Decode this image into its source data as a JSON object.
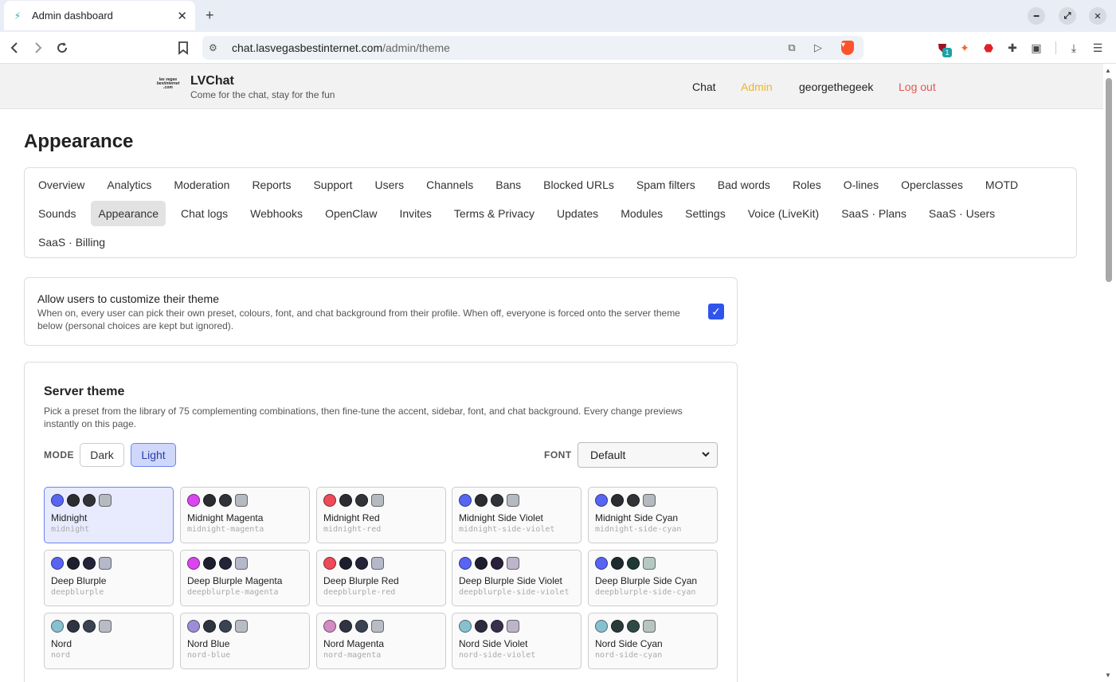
{
  "browser": {
    "tab_title": "Admin dashboard",
    "url_host": "chat.lasvegasbestinternet.com",
    "url_path": "/admin/theme",
    "extension_badge": "1"
  },
  "site": {
    "logo_text": "las vegas bestinternet .com",
    "brand": "LVChat",
    "tagline": "Come for the chat, stay for the fun",
    "nav": {
      "chat": "Chat",
      "admin": "Admin",
      "user": "georgethegeek",
      "logout": "Log out"
    },
    "colors": {
      "admin_link": "#f0b429",
      "logout_link": "#e45656"
    }
  },
  "page": {
    "title": "Appearance"
  },
  "admin_tabs": [
    "Overview",
    "Analytics",
    "Moderation",
    "Reports",
    "Support",
    "Users",
    "Channels",
    "Bans",
    "Blocked URLs",
    "Spam filters",
    "Bad words",
    "Roles",
    "O-lines",
    "Operclasses",
    "MOTD",
    "Sounds",
    "Appearance",
    "Chat logs",
    "Webhooks",
    "OpenClaw",
    "Invites",
    "Terms & Privacy",
    "Updates",
    "Modules",
    "Settings",
    "Voice (LiveKit)",
    "SaaS · Plans",
    "SaaS · Users",
    "SaaS · Billing"
  ],
  "active_tab": "Appearance",
  "allow_customize": {
    "title": "Allow users to customize their theme",
    "description": "When on, every user can pick their own preset, colours, font, and chat background from their profile. When off, everyone is forced onto the server theme below (personal choices are kept but ignored).",
    "checked": true
  },
  "server_theme": {
    "title": "Server theme",
    "description": "Pick a preset from the library of 75 complementing combinations, then fine-tune the accent, sidebar, font, and chat background. Every change previews instantly on this page.",
    "mode_label": "MODE",
    "mode_options": [
      "Dark",
      "Light"
    ],
    "mode_selected": "Light",
    "font_label": "FONT",
    "font_value": "Default"
  },
  "presets": [
    {
      "name": "Midnight",
      "slug": "midnight",
      "colors": [
        "#5865f2",
        "#2b2d31",
        "#313338",
        "#b5bac1"
      ],
      "selected": true
    },
    {
      "name": "Midnight Magenta",
      "slug": "midnight-magenta",
      "colors": [
        "#d946ef",
        "#2b2d31",
        "#313338",
        "#b5bac1"
      ]
    },
    {
      "name": "Midnight Red",
      "slug": "midnight-red",
      "colors": [
        "#ef4a5a",
        "#2b2d31",
        "#313338",
        "#b5bac1"
      ]
    },
    {
      "name": "Midnight Side Violet",
      "slug": "midnight-side-violet",
      "colors": [
        "#5865f2",
        "#2b2d31",
        "#313338",
        "#b5bac1"
      ]
    },
    {
      "name": "Midnight Side Cyan",
      "slug": "midnight-side-cyan",
      "colors": [
        "#5865f2",
        "#2b2d31",
        "#313338",
        "#b5bac1"
      ]
    },
    {
      "name": "Deep Blurple",
      "slug": "deepblurple",
      "colors": [
        "#5865f2",
        "#1e1f2e",
        "#232438",
        "#b5b8c8"
      ]
    },
    {
      "name": "Deep Blurple Magenta",
      "slug": "deepblurple-magenta",
      "colors": [
        "#d946ef",
        "#1e1f2e",
        "#232438",
        "#b5b8c8"
      ]
    },
    {
      "name": "Deep Blurple Red",
      "slug": "deepblurple-red",
      "colors": [
        "#ef4a5a",
        "#1e1f2e",
        "#232438",
        "#b5b8c8"
      ]
    },
    {
      "name": "Deep Blurple Side Violet",
      "slug": "deepblurple-side-violet",
      "colors": [
        "#5865f2",
        "#1e1f2e",
        "#2a1f3d",
        "#bdb5c8"
      ]
    },
    {
      "name": "Deep Blurple Side Cyan",
      "slug": "deepblurple-side-cyan",
      "colors": [
        "#5865f2",
        "#1e2a2e",
        "#1f3833",
        "#b5c8c2"
      ]
    },
    {
      "name": "Nord",
      "slug": "nord",
      "colors": [
        "#88c0d0",
        "#2e3440",
        "#3b4252",
        "#b8bcc4"
      ]
    },
    {
      "name": "Nord Blue",
      "slug": "nord-blue",
      "colors": [
        "#9a8ed8",
        "#2e3440",
        "#3b4252",
        "#b8bcc4"
      ]
    },
    {
      "name": "Nord Magenta",
      "slug": "nord-magenta",
      "colors": [
        "#d38bc4",
        "#2e3440",
        "#3b4252",
        "#b8bcc4"
      ]
    },
    {
      "name": "Nord Side Violet",
      "slug": "nord-side-violet",
      "colors": [
        "#88c0d0",
        "#2e2a3f",
        "#3a2f4d",
        "#bcb5c8"
      ]
    },
    {
      "name": "Nord Side Cyan",
      "slug": "nord-side-cyan",
      "colors": [
        "#88c0d0",
        "#2a3a3a",
        "#2f4a44",
        "#b8c4c0"
      ]
    }
  ]
}
